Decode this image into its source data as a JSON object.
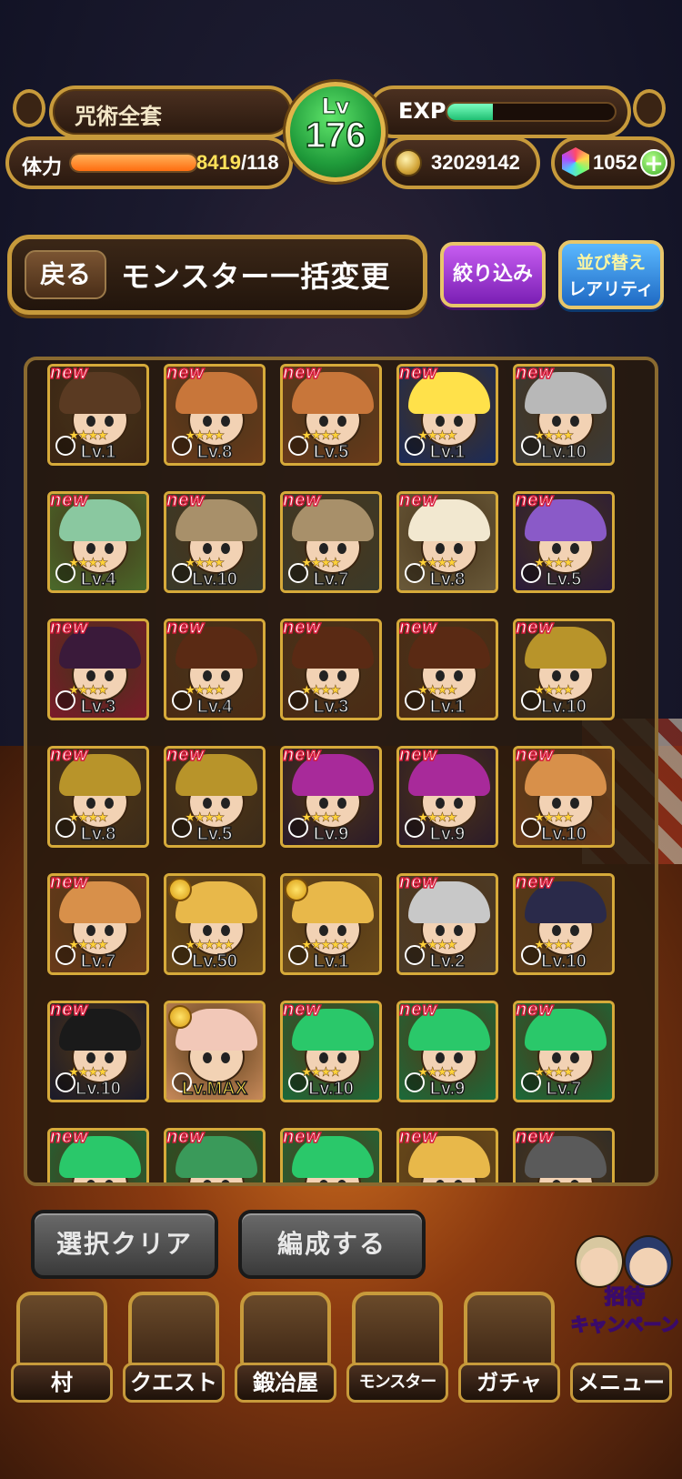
{
  "player": {
    "name": "咒術全套",
    "level_label": "Lv",
    "level": "176",
    "exp_label": "EXP",
    "exp_progress": 0.27,
    "stamina_label": "体力",
    "stamina_current": "8419",
    "stamina_max": "/118",
    "stamina_progress": 1.0,
    "coins": "32029142",
    "gems": "1052",
    "gem_add": "+"
  },
  "header": {
    "back_label": "戻る",
    "title": "モンスター一括変更",
    "filter_label": "絞り込み",
    "sort_label": "並び替え",
    "sort_value": "レアリティ"
  },
  "monsters": [
    {
      "new": "new",
      "level": "Lv.1",
      "hair": "#5a3a22",
      "bg": "#3a2414",
      "stars": "★★★★"
    },
    {
      "new": "new",
      "level": "Lv.8",
      "hair": "#c8763a",
      "bg": "#6a3a1a",
      "stars": "★★★★"
    },
    {
      "new": "new",
      "level": "Lv.5",
      "hair": "#c8763a",
      "bg": "#6a3a1a",
      "stars": "★★★★"
    },
    {
      "new": "new",
      "level": "Lv.1",
      "hair": "#ffe14a",
      "bg": "#1a2a5a",
      "stars": "★★★★"
    },
    {
      "new": "new",
      "level": "Lv.10",
      "hair": "#b8b8b8",
      "bg": "#3a3a3a",
      "stars": "★★★★"
    },
    {
      "new": "new",
      "level": "Lv.4",
      "hair": "#8ac8a0",
      "bg": "#4a6a2a",
      "stars": "★★★★"
    },
    {
      "new": "new",
      "level": "Lv.10",
      "hair": "#a8906a",
      "bg": "#3a3a2a",
      "stars": "★★★★"
    },
    {
      "new": "new",
      "level": "Lv.7",
      "hair": "#a8906a",
      "bg": "#3a3a2a",
      "stars": "★★★★"
    },
    {
      "new": "new",
      "level": "Lv.8",
      "hair": "#f2e8d0",
      "bg": "#6a5a3a",
      "stars": "★★★★"
    },
    {
      "new": "new",
      "level": "Lv.5",
      "hair": "#8a5ac8",
      "bg": "#2a1a3a",
      "stars": "★★★★"
    },
    {
      "new": "new",
      "level": "Lv.3",
      "hair": "#3a1a3a",
      "bg": "#7a1a2a",
      "stars": "★★★★"
    },
    {
      "new": "new",
      "level": "Lv.4",
      "hair": "#5a2a14",
      "bg": "#4a2a14",
      "stars": "★★★★"
    },
    {
      "new": "new",
      "level": "Lv.3",
      "hair": "#5a2a14",
      "bg": "#4a2a14",
      "stars": "★★★★"
    },
    {
      "new": "new",
      "level": "Lv.1",
      "hair": "#5a2a14",
      "bg": "#4a2a14",
      "stars": "★★★★"
    },
    {
      "new": "new",
      "level": "Lv.10",
      "hair": "#b8942a",
      "bg": "#3a2a1a",
      "stars": "★★★★"
    },
    {
      "new": "new",
      "level": "Lv.8",
      "hair": "#b8942a",
      "bg": "#3a2a1a",
      "stars": "★★★★"
    },
    {
      "new": "new",
      "level": "Lv.5",
      "hair": "#b8942a",
      "bg": "#3a2a1a",
      "stars": "★★★★"
    },
    {
      "new": "new",
      "level": "Lv.9",
      "hair": "#a82a9a",
      "bg": "#2a1a2a",
      "stars": "★★★★"
    },
    {
      "new": "new",
      "level": "Lv.9",
      "hair": "#a82a9a",
      "bg": "#2a1a2a",
      "stars": "★★★★"
    },
    {
      "new": "new",
      "level": "Lv.10",
      "hair": "#d8904a",
      "bg": "#6a3a1a",
      "stars": "★★★★"
    },
    {
      "new": "new",
      "level": "Lv.7",
      "hair": "#d8904a",
      "bg": "#6a3a1a",
      "stars": "★★★★"
    },
    {
      "new": "",
      "level": "Lv.50",
      "hair": "#e8b84a",
      "bg": "#6a4a1a",
      "stars": "★★★★★",
      "bolt": true
    },
    {
      "new": "",
      "level": "Lv.1",
      "hair": "#e8b84a",
      "bg": "#6a4a1a",
      "stars": "★★★★★",
      "bolt": true
    },
    {
      "new": "new",
      "level": "Lv.2",
      "hair": "#c8c8c8",
      "bg": "#4a3a2a",
      "stars": "★★★★"
    },
    {
      "new": "new",
      "level": "Lv.10",
      "hair": "#2a2a4a",
      "bg": "#5a3a1a",
      "stars": "★★★★"
    },
    {
      "new": "new",
      "level": "Lv.10",
      "hair": "#1a1a1a",
      "bg": "#1a1a2a",
      "stars": "★★★★"
    },
    {
      "new": "",
      "level": "Lv.MAX",
      "hair": "#f2c8b8",
      "bg": "#c88a5a",
      "stars": "",
      "bolt": true,
      "max": true
    },
    {
      "new": "new",
      "level": "Lv.10",
      "hair": "#2ac86a",
      "bg": "#1a6a3a",
      "stars": "★★★★"
    },
    {
      "new": "new",
      "level": "Lv.9",
      "hair": "#2ac86a",
      "bg": "#1a6a3a",
      "stars": "★★★★"
    },
    {
      "new": "new",
      "level": "Lv.7",
      "hair": "#2ac86a",
      "bg": "#1a6a3a",
      "stars": "★★★★"
    },
    {
      "new": "new",
      "level": "",
      "hair": "#2ac86a",
      "bg": "#1a6a3a",
      "stars": ""
    },
    {
      "new": "new",
      "level": "",
      "hair": "#3a9a5a",
      "bg": "#1a5a2a",
      "stars": ""
    },
    {
      "new": "new",
      "level": "",
      "hair": "#2ac86a",
      "bg": "#1a6a3a",
      "stars": ""
    },
    {
      "new": "new",
      "level": "",
      "hair": "#e8b84a",
      "bg": "#6a4a1a",
      "stars": ""
    },
    {
      "new": "new",
      "level": "",
      "hair": "#5a5a5a",
      "bg": "#2a2a2a",
      "stars": ""
    }
  ],
  "actions": {
    "clear_label": "選択クリア",
    "form_label": "編成する"
  },
  "nav": [
    {
      "label": "村",
      "icon": "village-icon",
      "small": false
    },
    {
      "label": "クエスト",
      "icon": "cave-icon",
      "small": false
    },
    {
      "label": "鍛冶屋",
      "icon": "hammer-icon",
      "small": false
    },
    {
      "label": "モンスター",
      "icon": "monster-icon",
      "small": true
    },
    {
      "label": "ガチャ",
      "icon": "egg-icon",
      "small": false
    },
    {
      "label": "メニュー",
      "icon": "menu-icon",
      "small": false
    }
  ],
  "campaign": {
    "line1": "招待",
    "line2": "キャンペーン"
  },
  "colors": {
    "gold_border": "#c79a3b",
    "level_green": "#1f9a3a",
    "new_red": "#d81a3a",
    "filter_purple": "#a83ed8",
    "sort_blue": "#2a86e0"
  }
}
